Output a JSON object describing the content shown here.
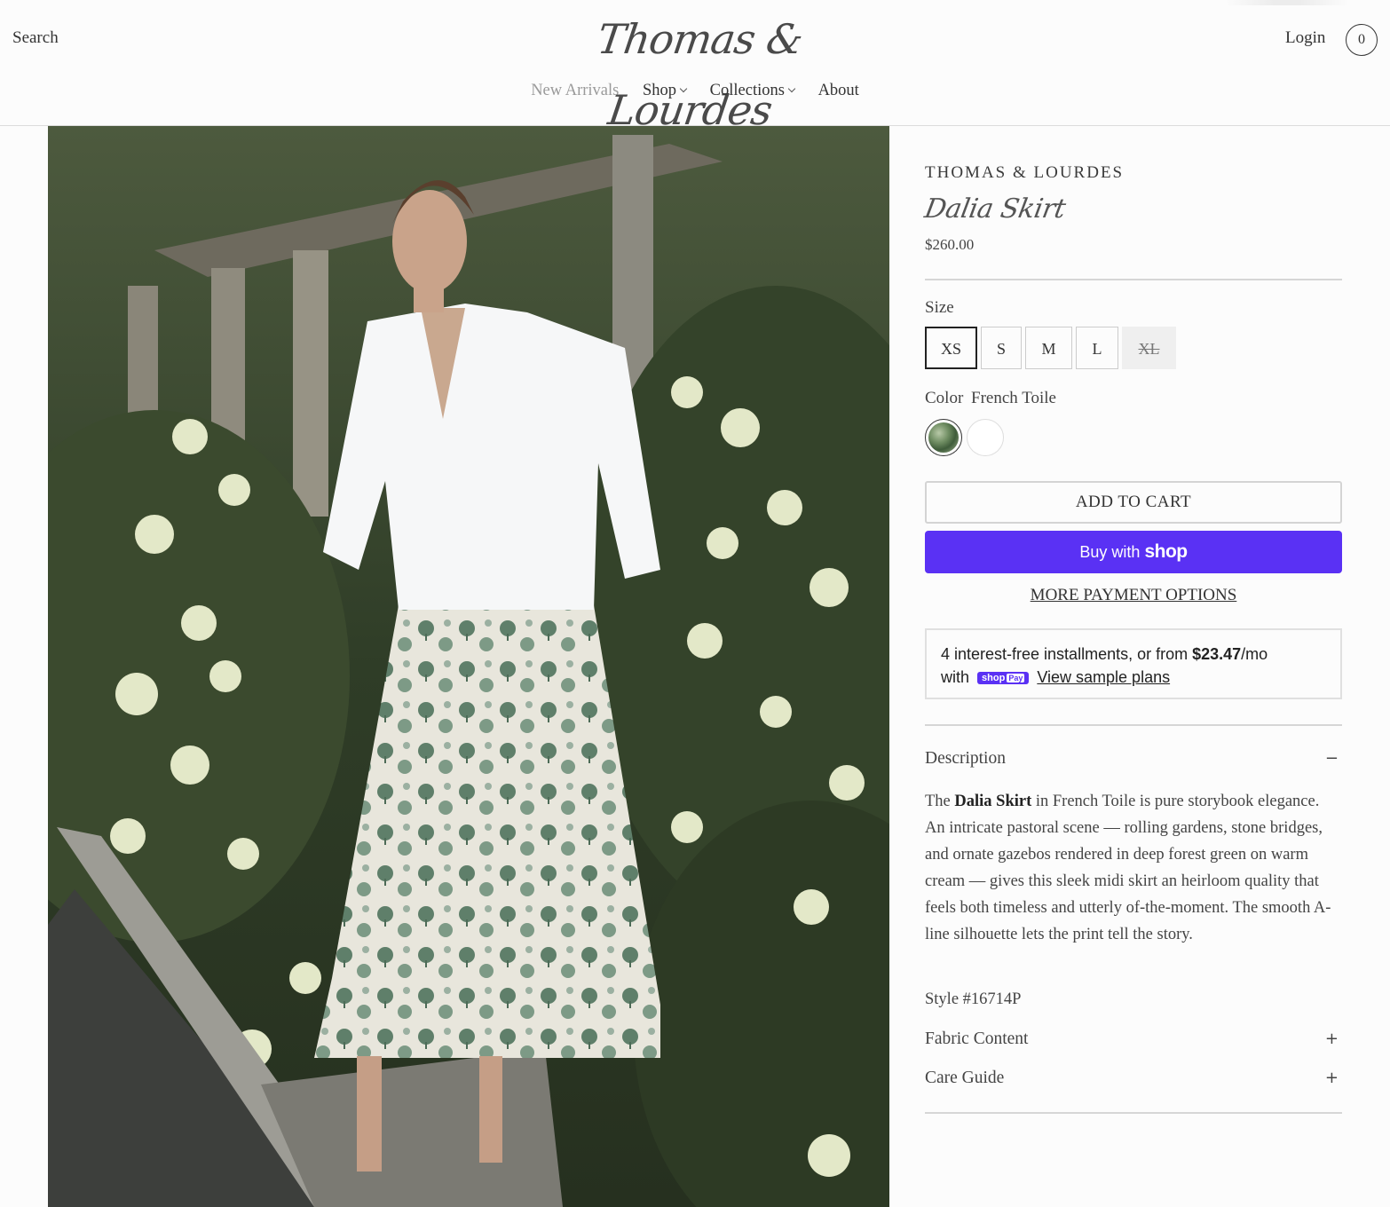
{
  "header": {
    "search_label": "Search",
    "logo_text": "Thomas & Lourdes",
    "login_label": "Login",
    "cart_count": "0"
  },
  "nav": {
    "items": [
      {
        "label": "New Arrivals",
        "has_dropdown": false
      },
      {
        "label": "Shop",
        "has_dropdown": true
      },
      {
        "label": "Collections",
        "has_dropdown": true
      },
      {
        "label": "About",
        "has_dropdown": false
      }
    ]
  },
  "product": {
    "vendor": "THOMAS & LOURDES",
    "title": "Dalia Skirt",
    "price": "$260.00",
    "size_label": "Size",
    "sizes": [
      {
        "label": "XS",
        "selected": true,
        "available": true
      },
      {
        "label": "S",
        "selected": false,
        "available": true
      },
      {
        "label": "M",
        "selected": false,
        "available": true
      },
      {
        "label": "L",
        "selected": false,
        "available": true
      },
      {
        "label": "XL",
        "selected": false,
        "available": false
      }
    ],
    "color_label": "Color",
    "color_value": "French Toile",
    "add_to_cart": "ADD TO CART",
    "buy_with": "Buy with",
    "buy_brand": "shop",
    "more_payment": "MORE PAYMENT OPTIONS",
    "installments": {
      "text_before": "4 interest-free installments, or from ",
      "amount": "$23.47",
      "text_after": "/mo",
      "with": "with",
      "badge_shop": "shop",
      "badge_pay": "Pay",
      "link": "View sample plans"
    },
    "description": {
      "heading": "Description",
      "sign": "−",
      "intro": "The ",
      "bold": "Dalia Skirt",
      "body": " in French Toile is pure storybook elegance. An intricate pastoral scene — rolling gardens, stone bridges, and ornate gazebos rendered in deep forest green on warm cream — gives this sleek midi skirt an heirloom quality that feels both timeless and utterly of-the-moment. The smooth A-line silhouette lets the print tell the story.",
      "style": "Style #16714P"
    },
    "fabric": {
      "heading": "Fabric Content",
      "sign": "+"
    },
    "care": {
      "heading": "Care Guide",
      "sign": "+"
    }
  },
  "colors": {
    "accent": "#5a31f4",
    "text": "#2b2b2b",
    "muted": "#9a9a9a"
  }
}
